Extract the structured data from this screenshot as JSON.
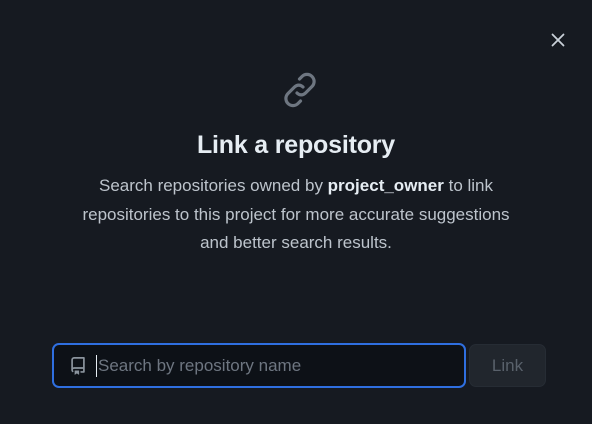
{
  "dialog": {
    "close_icon": "close-icon",
    "header_icon": "link-icon",
    "title": "Link a repository",
    "description": {
      "before": "Search repositories owned by ",
      "owner": "project_owner",
      "after": " to link repositories to this project for more accurate suggestions and better search results."
    },
    "search": {
      "icon": "repo-icon",
      "value": "",
      "placeholder": "Search by repository name"
    },
    "link_button_label": "Link",
    "colors": {
      "background": "#161a21",
      "focus_border": "#2f6fe0",
      "disabled_button_text": "#59616b"
    }
  }
}
